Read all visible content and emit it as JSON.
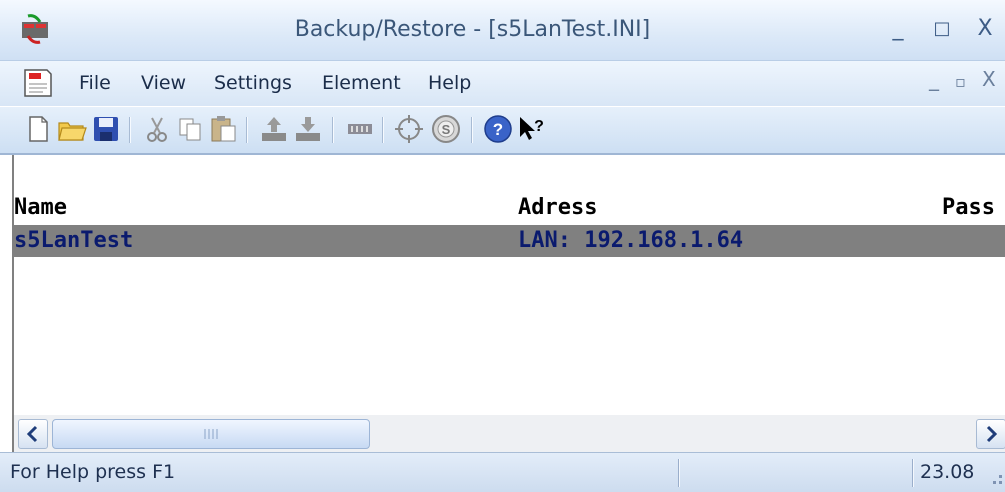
{
  "window": {
    "title": "Backup/Restore - [s5LanTest.INI]",
    "minimize_glyph": "_",
    "maximize_glyph": "□",
    "close_glyph": "X"
  },
  "menu": {
    "items": [
      "File",
      "View",
      "Settings",
      "Element",
      "Help"
    ],
    "mdi_minimize_glyph": "_",
    "mdi_restore_glyph": "▫",
    "mdi_close_glyph": "X"
  },
  "toolbar": {
    "icons": [
      "new-file-icon",
      "open-folder-icon",
      "save-icon",
      "cut-icon",
      "copy-icon",
      "paste-icon",
      "upload-icon",
      "download-icon",
      "connector-icon",
      "target-icon",
      "s-circle-icon",
      "help-icon",
      "context-help-icon"
    ]
  },
  "table": {
    "columns": [
      "Name",
      "Adress",
      "Pass"
    ],
    "rows": [
      {
        "name": "s5LanTest",
        "address": "LAN: 192.168.1.64",
        "pass": ""
      }
    ]
  },
  "statusbar": {
    "help_text": "For Help press F1",
    "value": "23.08"
  },
  "colors": {
    "selected_row_bg": "#808080",
    "selected_row_text": "#0a1a6e",
    "title_text": "#3b5779"
  }
}
